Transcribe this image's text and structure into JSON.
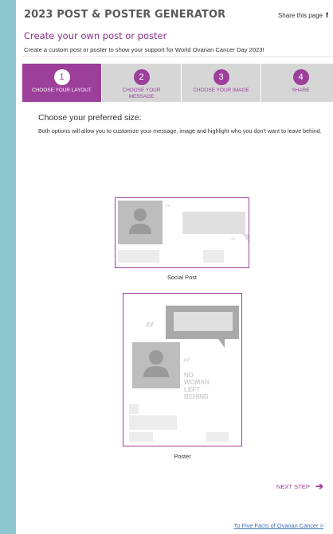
{
  "header": {
    "title": "2023 POST & POSTER GENERATOR",
    "share_label": "Share this page",
    "share_icon": "facebook-icon"
  },
  "main": {
    "subtitle": "Create your own post or poster",
    "intro": "Create a custom post or poster to show your support for World Ovarian Cancer Day 2023!",
    "preferred_title": "Choose your preferred size:",
    "preferred_desc": "Both options will allow you to customize your message, image and highlight who you don't want to leave behind."
  },
  "steps": [
    {
      "num": "1",
      "label": "Choose your layout",
      "active": true
    },
    {
      "num": "2",
      "label": "Choose your message",
      "active": false
    },
    {
      "num": "3",
      "label": "Choose your image",
      "active": false
    },
    {
      "num": "4",
      "label": "Share",
      "active": false
    }
  ],
  "options": {
    "social_label": "Social Post",
    "poster_label": "Poster",
    "poster_text": [
      "NO",
      "WOMAN",
      "LEFT",
      "BEHIND"
    ]
  },
  "nav": {
    "next_label": "NEXT STEP",
    "footer_link": "To Five Facts of Ovarian Cancer >"
  },
  "colors": {
    "accent": "#9b3f9a",
    "inactive_step": "#d6d6d6",
    "background": "#8ec6cf",
    "link": "#3b6fb4"
  }
}
